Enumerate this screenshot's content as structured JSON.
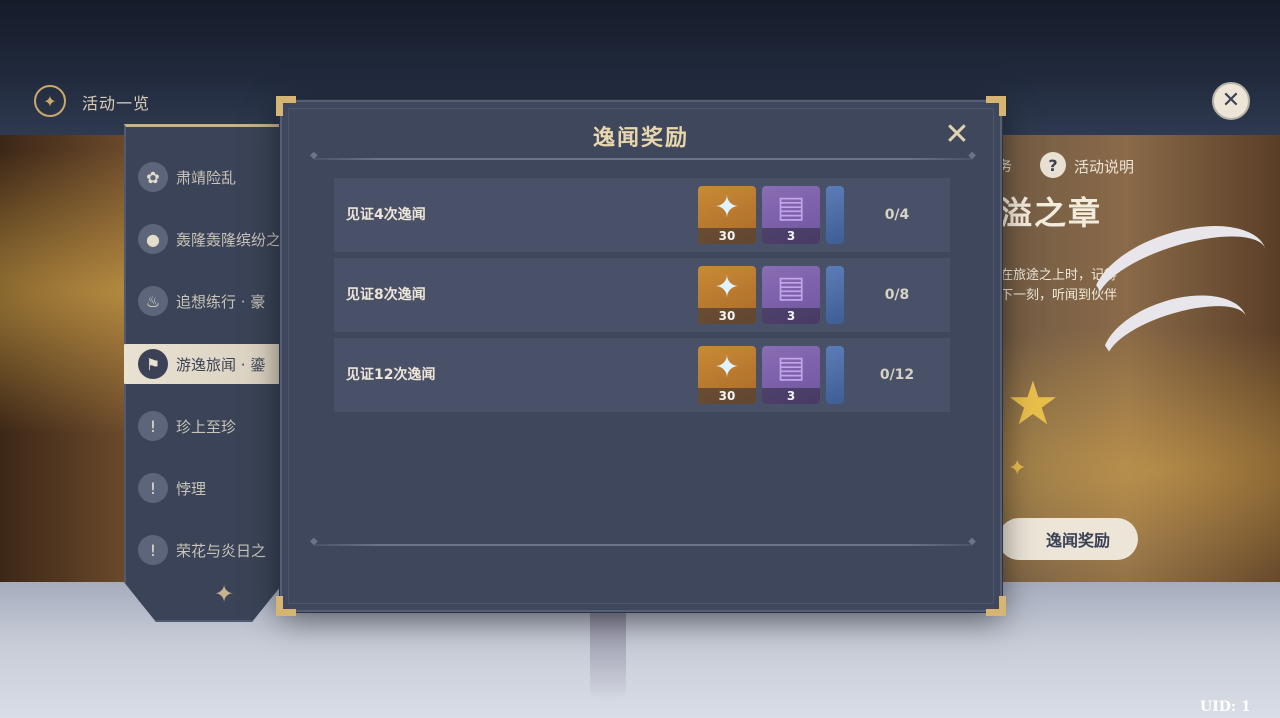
{
  "header": {
    "icon": "compass-icon",
    "title": "活动一览"
  },
  "top_close_icon": "close-icon",
  "sidebar": {
    "items": [
      {
        "label": "肃靖险乱",
        "icon": "flower-icon",
        "active": false
      },
      {
        "label": "轰隆轰隆缤纷之",
        "icon": "bomb-face-icon",
        "active": false
      },
      {
        "label": "追想练行 · 豪",
        "icon": "flame-icon",
        "active": false
      },
      {
        "label": "游逸旅闻 · 鎏",
        "icon": "map-pin-icon",
        "active": true
      },
      {
        "label": "珍上至珍",
        "icon": "exclamation-icon",
        "active": false
      },
      {
        "label": "悖理",
        "icon": "exclamation-icon",
        "active": false
      },
      {
        "label": "荣花与炎日之",
        "icon": "exclamation-icon",
        "active": false
      }
    ]
  },
  "banner": {
    "tab_fragment": "务",
    "help_label": "活动说明",
    "title": "溢之章",
    "description_lines": [
      "在旅途之上时，记得",
      "下一刻，听闻到伙伴"
    ],
    "rewards_button": "逸闻奖励"
  },
  "modal": {
    "title": "逸闻奖励",
    "close_icon": "close-icon",
    "rows": [
      {
        "label": "见证4次逸闻",
        "items": [
          {
            "icon": "primogem-icon",
            "count": "30"
          },
          {
            "icon": "book-icon",
            "count": "3"
          }
        ],
        "progress": "0/4"
      },
      {
        "label": "见证8次逸闻",
        "items": [
          {
            "icon": "primogem-icon",
            "count": "30"
          },
          {
            "icon": "book-icon",
            "count": "3"
          }
        ],
        "progress": "0/8"
      },
      {
        "label": "见证12次逸闻",
        "items": [
          {
            "icon": "primogem-icon",
            "count": "30"
          },
          {
            "icon": "book-icon",
            "count": "3"
          }
        ],
        "progress": "0/12"
      }
    ]
  },
  "uid": "UID: 1",
  "colors": {
    "accent_gold": "#d6b572",
    "panel": "#3f475d",
    "row": "#495168",
    "primogem_bg": "#c98a36",
    "book_bg": "#8a6db4"
  }
}
